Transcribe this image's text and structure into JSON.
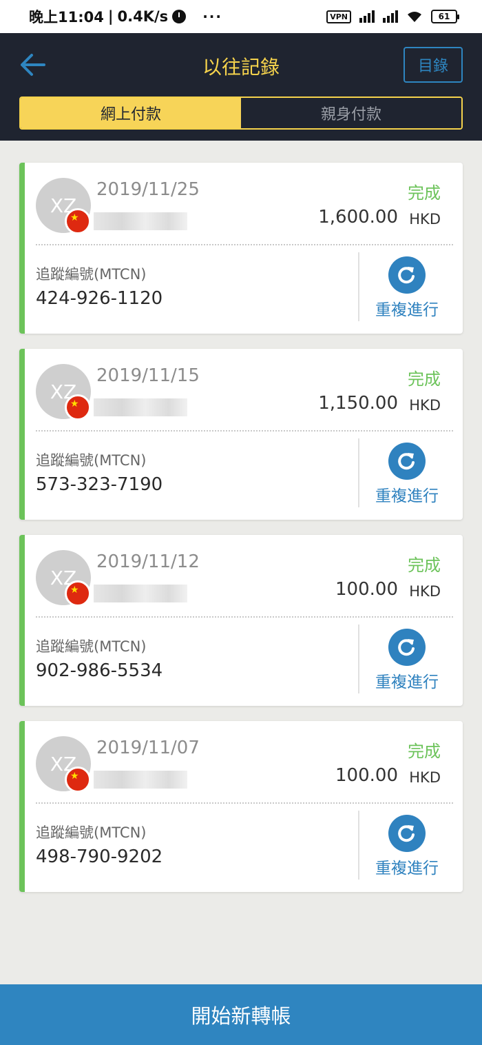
{
  "status_bar": {
    "time": "晚上11:04",
    "speed": "0.4K/s",
    "dots": "···",
    "vpn": "VPN",
    "battery": "61"
  },
  "header": {
    "title": "以往記錄",
    "catalog_label": "目錄",
    "tabs": [
      {
        "label": "網上付款",
        "active": true
      },
      {
        "label": "親身付款",
        "active": false
      }
    ]
  },
  "records": [
    {
      "avatar": "XZ",
      "date": "2019/11/25",
      "status": "完成",
      "amount": "1,600.00",
      "currency": "HKD",
      "mtcn_label": "追蹤編號(MTCN)",
      "mtcn": "424-926-1120",
      "repeat_label": "重複進行"
    },
    {
      "avatar": "XZ",
      "date": "2019/11/15",
      "status": "完成",
      "amount": "1,150.00",
      "currency": "HKD",
      "mtcn_label": "追蹤編號(MTCN)",
      "mtcn": "573-323-7190",
      "repeat_label": "重複進行"
    },
    {
      "avatar": "XZ",
      "date": "2019/11/12",
      "status": "完成",
      "amount": "100.00",
      "currency": "HKD",
      "mtcn_label": "追蹤編號(MTCN)",
      "mtcn": "902-986-5534",
      "repeat_label": "重複進行"
    },
    {
      "avatar": "XZ",
      "date": "2019/11/07",
      "status": "完成",
      "amount": "100.00",
      "currency": "HKD",
      "mtcn_label": "追蹤編號(MTCN)",
      "mtcn": "498-790-9202",
      "repeat_label": "重複進行"
    }
  ],
  "footer": {
    "new_transfer_label": "開始新轉帳"
  },
  "colors": {
    "header_bg": "#1f2430",
    "accent_yellow": "#f6d34c",
    "accent_blue": "#2f85c0",
    "status_green": "#6cc35a"
  }
}
